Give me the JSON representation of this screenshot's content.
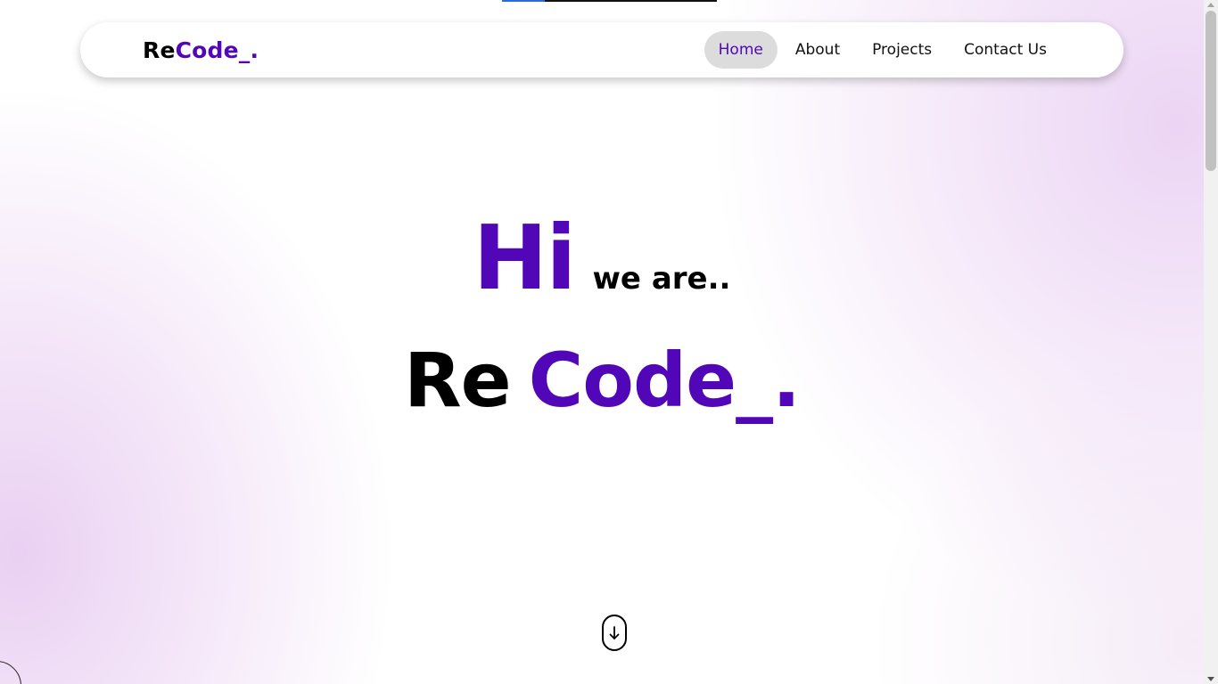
{
  "navbar": {
    "logo": {
      "part1": "Re",
      "part2": "Code_."
    },
    "links": [
      {
        "label": "Home",
        "active": true
      },
      {
        "label": "About",
        "active": false
      },
      {
        "label": "Projects",
        "active": false
      },
      {
        "label": "Contact Us",
        "active": false
      }
    ]
  },
  "hero": {
    "greeting": "Hi",
    "greeting_suffix": "we are..",
    "name_part1": "Re",
    "name_part2": "Code_."
  },
  "scroll_indicator": {
    "icon": "arrow-down-icon"
  },
  "colors": {
    "accent": "#5106b8",
    "text": "#000000",
    "active_link_bg": "#dcdcdc",
    "progress_bar": "#2b6bd8"
  },
  "reading_progress": 0.2
}
